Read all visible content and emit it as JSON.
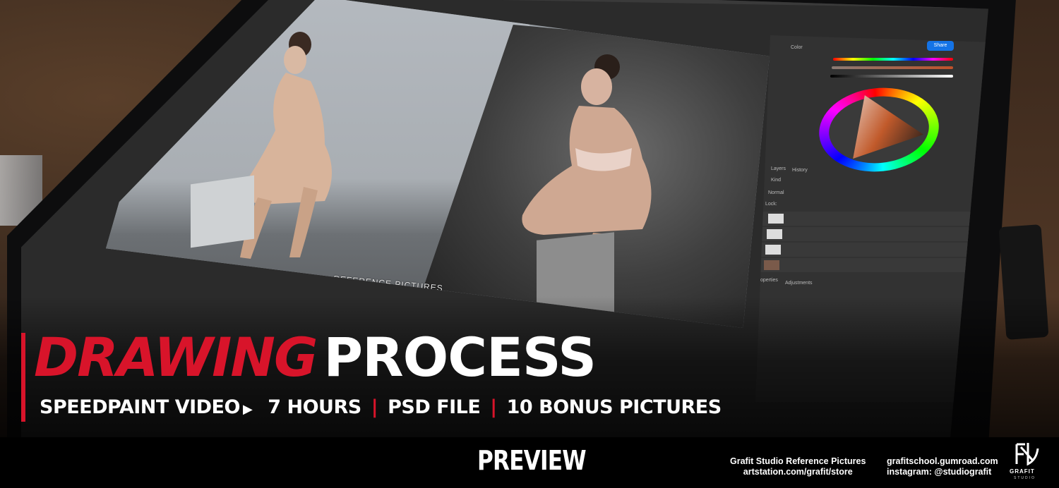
{
  "headline": {
    "word_red": "DRAWING",
    "word_white": "PROCESS"
  },
  "subline": {
    "item1": "SPEEDPAINT VIDEO",
    "play_icon": "▶",
    "item2": "7 HOURS",
    "separator": "|",
    "item3": "PSD FILE",
    "item4": "10 BONUS PICTURES"
  },
  "footer": {
    "preview": "PREVIEW",
    "studio_name": "Grafit Studio Reference Pictures",
    "artstation": "artstation.com/grafit/store",
    "gumroad": "grafitschool.gumroad.com",
    "instagram": "instagram: @studiografit",
    "logo_text": "GRAFIT",
    "logo_sub": "STUDIO"
  },
  "screen": {
    "reference_label": "REFERENCE PICTURES",
    "panels": {
      "color_tab": "Color",
      "share_button": "Share",
      "layers_tab": "Layers",
      "history_tab": "History",
      "kind_filter": "Kind",
      "blend_mode": "Normal",
      "lock_label": "Lock:",
      "properties_tab": "Properties",
      "adjustments_tab": "Adjustments"
    }
  },
  "colors": {
    "accent_red": "#d8142a",
    "headline_white": "#ffffff",
    "footer_bg": "#000000",
    "share_blue": "#1473e6"
  },
  "icons": [
    "play-icon",
    "grafit-logo-icon",
    "color-wheel-icon"
  ]
}
